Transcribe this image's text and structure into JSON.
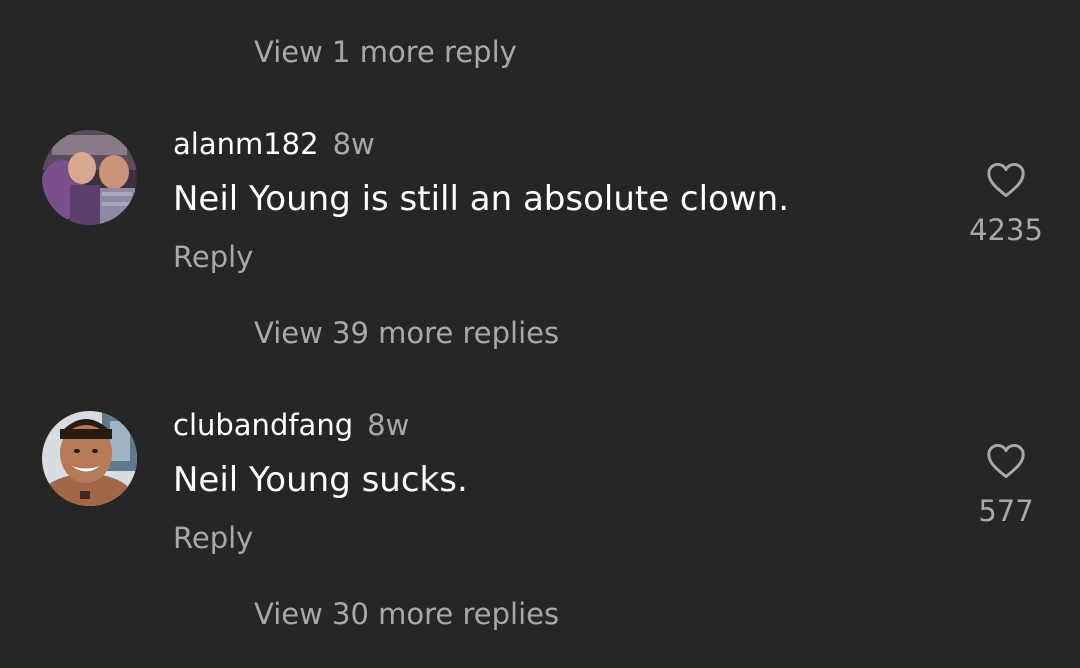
{
  "thread": {
    "top_view_more": "View 1 more reply",
    "comments": [
      {
        "username": "alanm182",
        "timestamp": "8w",
        "text": "Neil Young is still an absolute clown.",
        "reply_label": "Reply",
        "like_count": "4235",
        "view_more": "View 39 more replies",
        "avatar_icon": "profile-photo-two-men"
      },
      {
        "username": "clubandfang",
        "timestamp": "8w",
        "text": "Neil Young sucks.",
        "reply_label": "Reply",
        "like_count": "577",
        "view_more": "View 30 more replies",
        "avatar_icon": "profile-photo-smiling-man"
      }
    ]
  },
  "colors": {
    "background": "#262626",
    "primary_text": "#ffffff",
    "secondary_text": "#a8a8a8"
  },
  "icons": {
    "like": "heart-outline-icon"
  }
}
